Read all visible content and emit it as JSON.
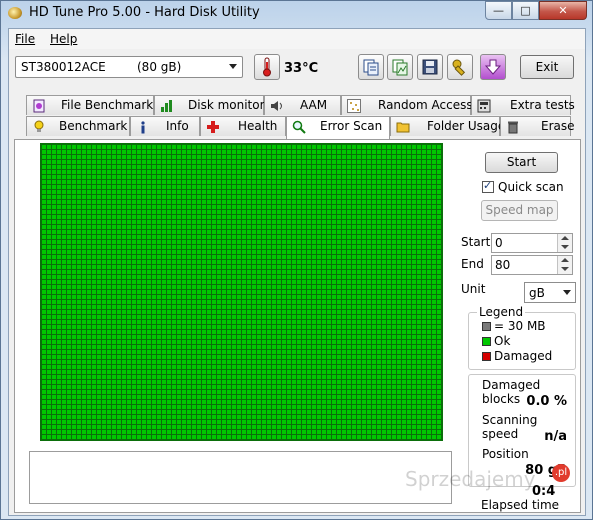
{
  "window": {
    "title": "HD Tune Pro 5.00 - Hard Disk Utility",
    "minimize_glyph": "—",
    "maximize_glyph": "□",
    "close_glyph": "✕"
  },
  "menu": {
    "file": "File",
    "help": "Help"
  },
  "toolbar": {
    "drive_name": "ST380012ACE",
    "drive_capacity": "(80 gB)",
    "temperature": "33°C",
    "exit_label": "Exit"
  },
  "tabs": {
    "row_top": [
      "File Benchmark",
      "Disk monitor",
      "AAM",
      "Random Access",
      "Extra tests"
    ],
    "row_bottom": [
      "Benchmark",
      "Info",
      "Health",
      "Error Scan",
      "Folder Usage",
      "Erase"
    ],
    "active": "Error Scan"
  },
  "scan": {
    "start_label": "Start",
    "quick_scan_label": "Quick scan",
    "quick_scan_checked": true,
    "speed_map_label": "Speed map",
    "start_field_label": "Start",
    "start_value": "0",
    "end_field_label": "End",
    "end_value": "80",
    "unit_label": "Unit",
    "unit_value": "gB"
  },
  "legend": {
    "title": "Legend",
    "block_size": "= 30 MB",
    "ok": "Ok",
    "damaged": "Damaged",
    "colors": {
      "block": "#7a7a7a",
      "ok": "#00c800",
      "damaged": "#d40000"
    }
  },
  "stats": {
    "damaged_blocks_label": "Damaged blocks",
    "damaged_blocks_value": "0.0 %",
    "scanning_speed_label": "Scanning speed",
    "scanning_speed_value": "n/a",
    "position_label": "Position",
    "position_value": "80 gB",
    "elapsed_label": "Elapsed time",
    "elapsed_value": "0:4"
  },
  "watermark": {
    "text": "Sprzedajemy",
    "badge": ".pl"
  }
}
